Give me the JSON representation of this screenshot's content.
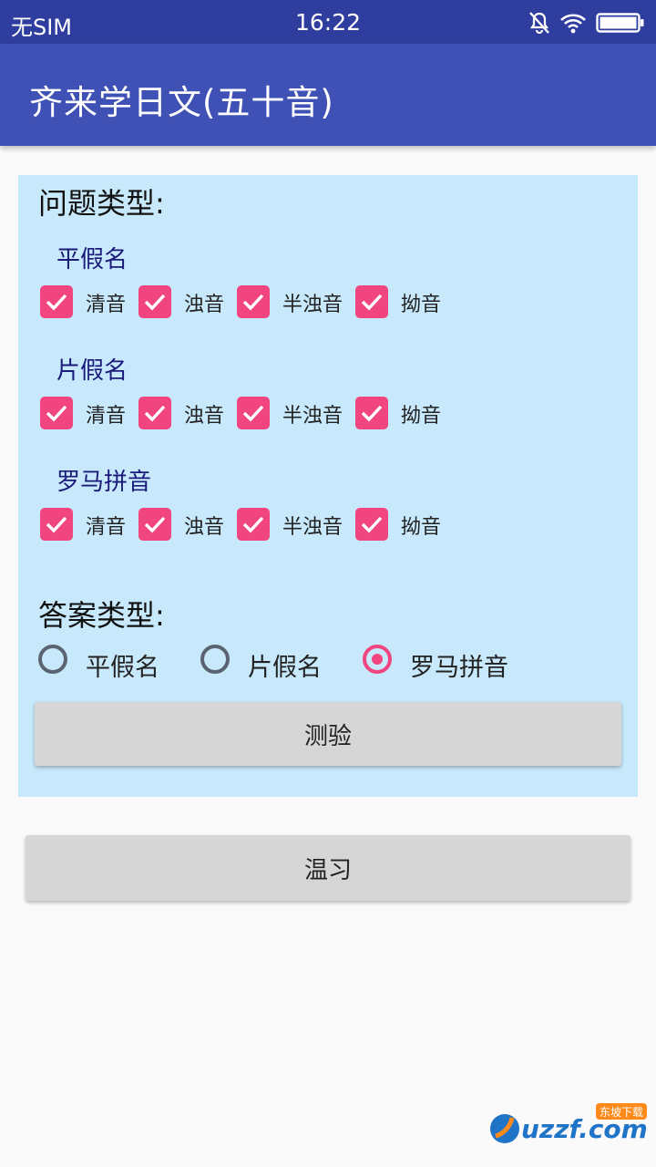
{
  "status_bar": {
    "carrier": "无SIM",
    "time": "16:22",
    "icons": [
      "mute-icon",
      "wifi-icon",
      "battery-icon"
    ]
  },
  "toolbar": {
    "title": "齐来学日文(五十音)"
  },
  "question_type": {
    "title": "问题类型:",
    "groups": [
      {
        "label": "平假名",
        "options": [
          {
            "label": "清音",
            "checked": true
          },
          {
            "label": "浊音",
            "checked": true
          },
          {
            "label": "半浊音",
            "checked": true
          },
          {
            "label": "拗音",
            "checked": true
          }
        ]
      },
      {
        "label": "片假名",
        "options": [
          {
            "label": "清音",
            "checked": true
          },
          {
            "label": "浊音",
            "checked": true
          },
          {
            "label": "半浊音",
            "checked": true
          },
          {
            "label": "拗音",
            "checked": true
          }
        ]
      },
      {
        "label": "罗马拼音",
        "options": [
          {
            "label": "清音",
            "checked": true
          },
          {
            "label": "浊音",
            "checked": true
          },
          {
            "label": "半浊音",
            "checked": true
          },
          {
            "label": "拗音",
            "checked": true
          }
        ]
      }
    ]
  },
  "answer_type": {
    "title": "答案类型:",
    "options": [
      {
        "label": "平假名",
        "selected": false
      },
      {
        "label": "片假名",
        "selected": false
      },
      {
        "label": "罗马拼音",
        "selected": true
      }
    ]
  },
  "buttons": {
    "quiz": "测验",
    "review": "温习"
  },
  "watermark": {
    "text": "uzzf.com",
    "badge": "东坡下载"
  },
  "colors": {
    "primary": "#3f51b5",
    "status_bar": "#2f3e9e",
    "accent": "#f0457f",
    "panel": "#c8e9fc"
  }
}
